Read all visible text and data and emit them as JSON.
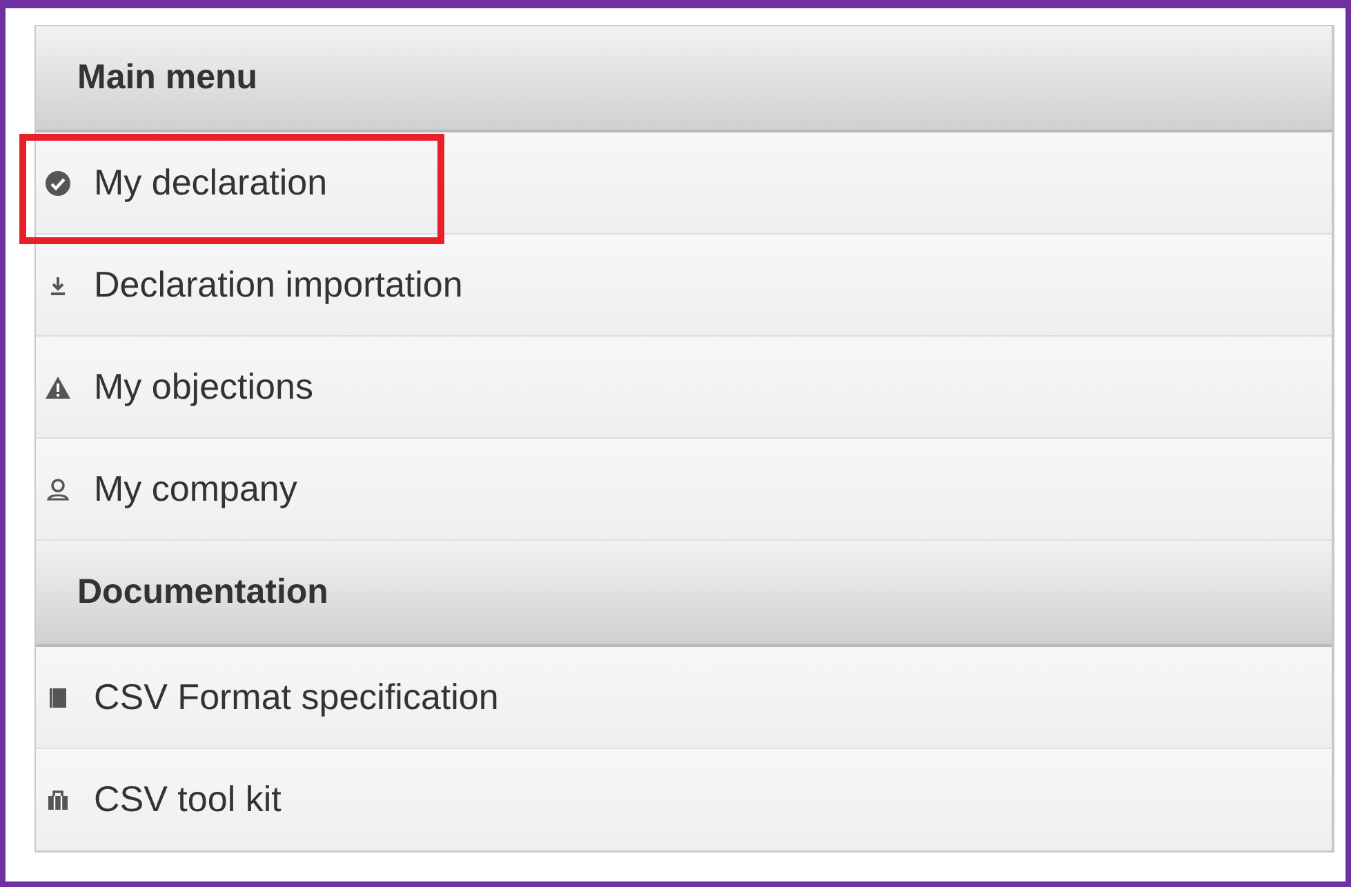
{
  "sections": [
    {
      "title": "Main menu",
      "items": [
        {
          "label": "My declaration",
          "highlighted": true
        },
        {
          "label": "Declaration importation",
          "highlighted": false
        },
        {
          "label": "My objections",
          "highlighted": false
        },
        {
          "label": "My company",
          "highlighted": false
        }
      ]
    },
    {
      "title": "Documentation",
      "items": [
        {
          "label": "CSV Format specification",
          "highlighted": false
        },
        {
          "label": "CSV tool kit",
          "highlighted": false
        }
      ]
    }
  ]
}
